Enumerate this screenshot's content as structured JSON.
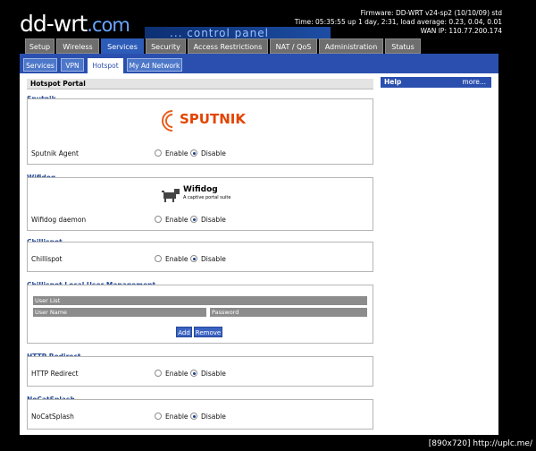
{
  "header": {
    "logo": "dd-wrt",
    "logo_suffix": ".com",
    "subtitle": "... control panel",
    "firmware": "Firmware: DD-WRT v24-sp2 (10/10/09) std",
    "time": "Time: 05:35:55 up 1 day, 2:31, load average: 0.23, 0.04, 0.01",
    "wan_ip": "WAN IP: 110.77.200.174"
  },
  "tabs": [
    "Setup",
    "Wireless",
    "Services",
    "Security",
    "Access Restrictions",
    "NAT / QoS",
    "Administration",
    "Status"
  ],
  "subtabs": [
    "Services",
    "VPN",
    "Hotspot",
    "My Ad Network"
  ],
  "section_title": "Hotspot Portal",
  "help": {
    "title": "Help",
    "more": "more..."
  },
  "sputnik": {
    "label": "Sputnik",
    "logo_text": "SPUTNIK",
    "row": "Sputnik Agent",
    "enable": "Enable",
    "disable": "Disable"
  },
  "wifidog": {
    "label": "Wifidog",
    "logo_text": "Wifidog",
    "logo_sub": "A captive portal suite",
    "row": "Wifidog daemon",
    "enable": "Enable",
    "disable": "Disable"
  },
  "chillispot": {
    "label": "Chillispot",
    "row": "Chillispot",
    "enable": "Enable",
    "disable": "Disable"
  },
  "local_users": {
    "label": "Chillispot Local User Management",
    "list_header": "User List",
    "col_user": "User Name",
    "col_pass": "Password",
    "add": "Add",
    "remove": "Remove"
  },
  "http_redirect": {
    "label": "HTTP Redirect",
    "row": "HTTP Redirect",
    "enable": "Enable",
    "disable": "Disable"
  },
  "nocatsplash": {
    "label": "NoCatSplash",
    "row": "NoCatSplash",
    "enable": "Enable",
    "disable": "Disable"
  },
  "footer": "[890x720] http://uplc.me/"
}
